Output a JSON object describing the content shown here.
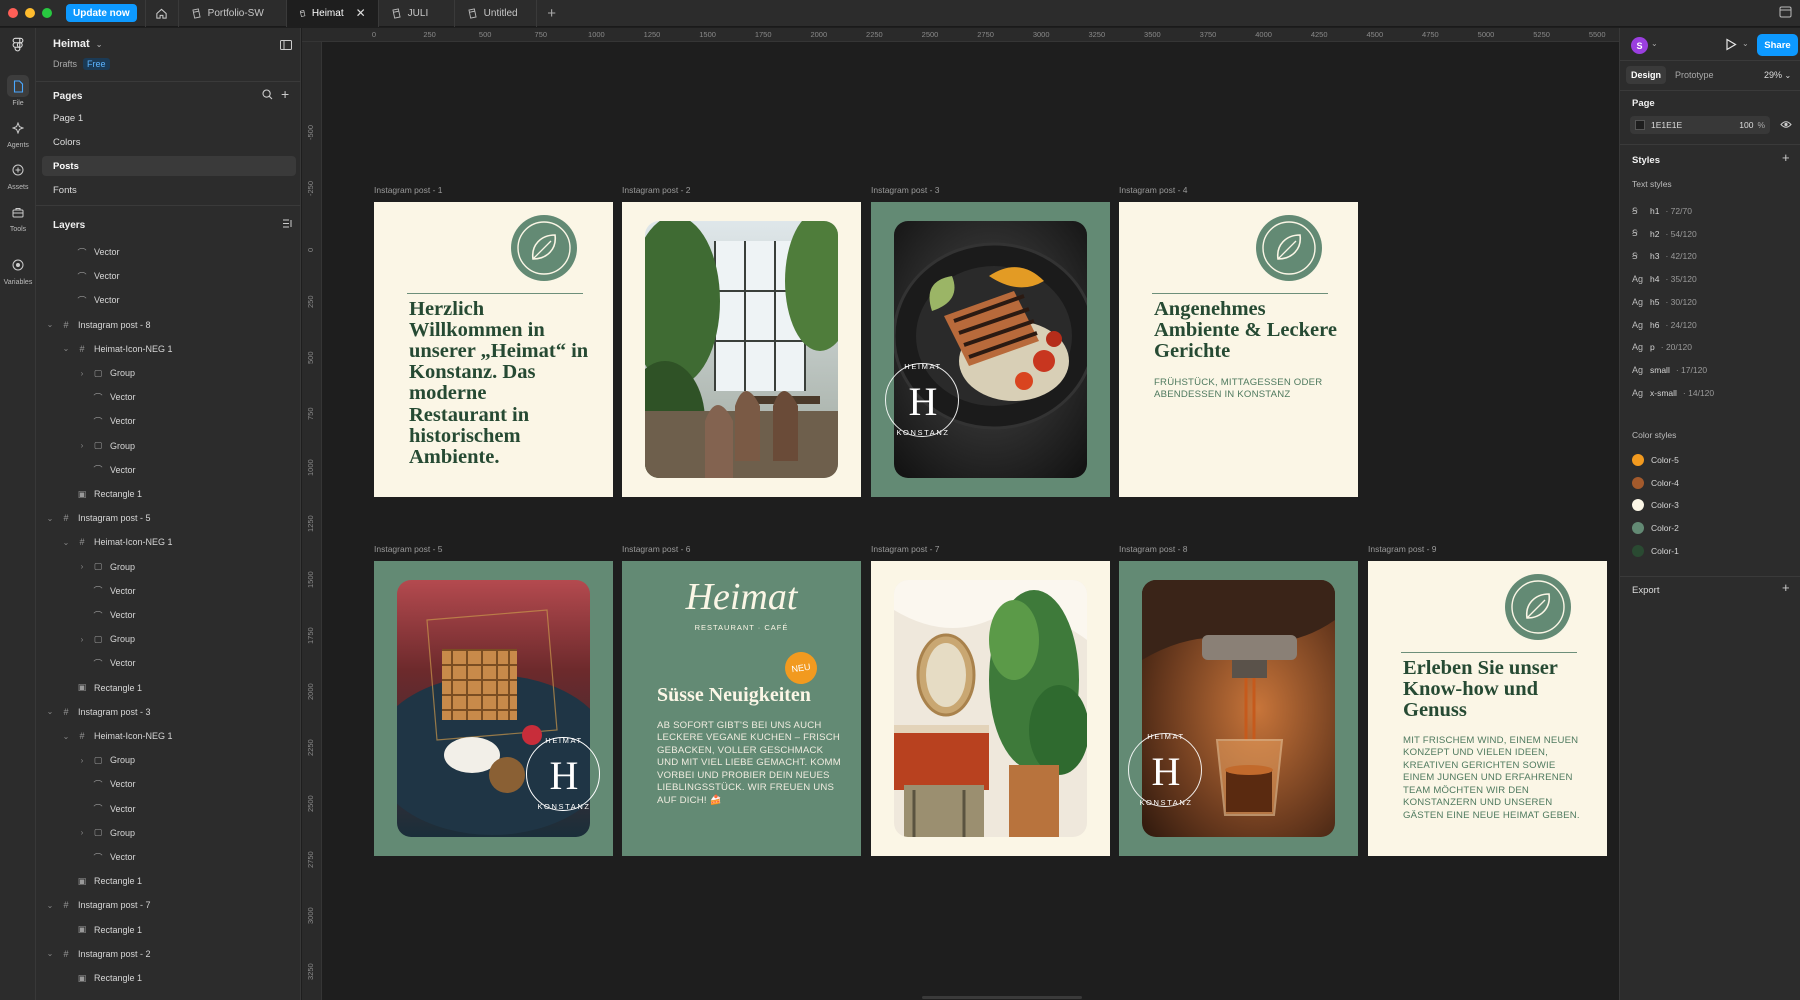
{
  "topbar": {
    "update_label": "Update now",
    "tabs": [
      {
        "label": "Portfolio-SW"
      },
      {
        "label": "Heimat"
      },
      {
        "label": "JULI"
      },
      {
        "label": "Untitled"
      }
    ]
  },
  "rail": {
    "items": [
      {
        "label": "File",
        "icon": "file-icon"
      },
      {
        "label": "Agents",
        "icon": "agents-icon"
      },
      {
        "label": "Assets",
        "icon": "assets-icon"
      },
      {
        "label": "Tools",
        "icon": "tools-icon"
      },
      {
        "label": "Variables",
        "icon": "variables-icon"
      }
    ]
  },
  "left_panel": {
    "file_name": "Heimat",
    "drafts": "Drafts",
    "plan": "Free",
    "pages_heading": "Pages",
    "pages": [
      "Page 1",
      "Colors",
      "Posts",
      "Fonts"
    ],
    "selected_page": "Posts",
    "layers_heading": "Layers",
    "layers": [
      {
        "name": "Vector",
        "type": "vector",
        "depth": 1
      },
      {
        "name": "Vector",
        "type": "vector",
        "depth": 1
      },
      {
        "name": "Vector",
        "type": "vector",
        "depth": 1
      },
      {
        "name": "Instagram post - 8",
        "type": "frame",
        "depth": 0
      },
      {
        "name": "Heimat-Icon-NEG 1",
        "type": "frame",
        "depth": 1
      },
      {
        "name": "Group",
        "type": "group",
        "depth": 2
      },
      {
        "name": "Vector",
        "type": "vector",
        "depth": 2
      },
      {
        "name": "Vector",
        "type": "vector",
        "depth": 2
      },
      {
        "name": "Group",
        "type": "group",
        "depth": 2
      },
      {
        "name": "Vector",
        "type": "vector",
        "depth": 2
      },
      {
        "name": "Rectangle 1",
        "type": "rect",
        "depth": 1
      },
      {
        "name": "Instagram post - 5",
        "type": "frame",
        "depth": 0
      },
      {
        "name": "Heimat-Icon-NEG 1",
        "type": "frame",
        "depth": 1
      },
      {
        "name": "Group",
        "type": "group",
        "depth": 2
      },
      {
        "name": "Vector",
        "type": "vector",
        "depth": 2
      },
      {
        "name": "Vector",
        "type": "vector",
        "depth": 2
      },
      {
        "name": "Group",
        "type": "group",
        "depth": 2
      },
      {
        "name": "Vector",
        "type": "vector",
        "depth": 2
      },
      {
        "name": "Rectangle 1",
        "type": "rect",
        "depth": 1
      },
      {
        "name": "Instagram post - 3",
        "type": "frame",
        "depth": 0
      },
      {
        "name": "Heimat-Icon-NEG 1",
        "type": "frame",
        "depth": 1
      },
      {
        "name": "Group",
        "type": "group",
        "depth": 2
      },
      {
        "name": "Vector",
        "type": "vector",
        "depth": 2
      },
      {
        "name": "Vector",
        "type": "vector",
        "depth": 2
      },
      {
        "name": "Group",
        "type": "group",
        "depth": 2
      },
      {
        "name": "Vector",
        "type": "vector",
        "depth": 2
      },
      {
        "name": "Rectangle 1",
        "type": "rect",
        "depth": 1
      },
      {
        "name": "Instagram post - 7",
        "type": "frame",
        "depth": 0
      },
      {
        "name": "Rectangle 1",
        "type": "rect",
        "depth": 1
      },
      {
        "name": "Instagram post - 2",
        "type": "frame",
        "depth": 0
      },
      {
        "name": "Rectangle 1",
        "type": "rect",
        "depth": 1
      }
    ]
  },
  "canvas": {
    "ruler_top": [
      "0",
      "250",
      "500",
      "750",
      "1000",
      "1250",
      "1500",
      "1750",
      "2000",
      "2250",
      "2500",
      "2750",
      "3000",
      "3250",
      "3500",
      "3750",
      "4000",
      "4250",
      "4500",
      "4750",
      "5000",
      "5250",
      "5500"
    ],
    "ruler_left": [
      "-500",
      "-250",
      "0",
      "250",
      "500",
      "750",
      "1000",
      "1250",
      "1500",
      "1750",
      "2000",
      "2250",
      "2500",
      "2750",
      "3000",
      "3250",
      "3500"
    ],
    "frames": {
      "p1": {
        "label": "Instagram post - 1",
        "headline": "Herzlich Willkommen in unserer „Heimat“ in Konstanz. Das moderne Restaurant in historischem Ambiente."
      },
      "p2": {
        "label": "Instagram post - 2",
        "photo": "restaurant interior with plants"
      },
      "p3": {
        "label": "Instagram post - 3",
        "seal_top": "HEIMAT",
        "seal_bottom": "KONSTANZ",
        "seal_letter": "H"
      },
      "p4": {
        "label": "Instagram post - 4",
        "headline": "Angenehmes Ambiente & Leckere Gerichte",
        "copy": "FRÜHSTÜCK, MITTAGESSEN ODER ABENDESSEN IN KONSTANZ"
      },
      "p5": {
        "label": "Instagram post - 5",
        "seal_top": "HEIMAT",
        "seal_bottom": "KONSTANZ",
        "seal_letter": "H"
      },
      "p6": {
        "label": "Instagram post - 6",
        "logo": "Heimat",
        "logo_sub": "RESTAURANT · CAFÉ",
        "badge": "NEU",
        "headline": "Süsse Neuigkeiten",
        "copy": "AB SOFORT GIBT'S BEI UNS AUCH LECKERE VEGANE KUCHEN – FRISCH GEBACKEN, VOLLER GESCHMACK UND MIT VIEL LIEBE GEMACHT. KOMM VORBEI UND PROBIER DEIN NEUES LIEBLINGSSTÜCK. WIR FREUEN UNS AUF DICH! 🍰"
      },
      "p7": {
        "label": "Instagram post - 7",
        "photo": "cafe interior with bench and plant"
      },
      "p8": {
        "label": "Instagram post - 8",
        "seal_top": "HEIMAT",
        "seal_bottom": "KONSTANZ",
        "seal_letter": "H"
      },
      "p9": {
        "label": "Instagram post - 9",
        "headline": "Erleben Sie unser Know-how und Genuss",
        "copy": "MIT FRISCHEM WIND, EINEM NEUEN KONZEPT UND VIELEN IDEEN, KREATIVEN GERICHTEN SOWIE EINEM JUNGEN UND ERFAHRENEN TEAM MÖCHTEN WIR DEN KONSTANZERN UND UNSEREN GÄSTEN EINE NEUE HEIMAT GEBEN."
      }
    }
  },
  "right_panel": {
    "avatar_letter": "S",
    "share_label": "Share",
    "tabs": [
      "Design",
      "Prototype"
    ],
    "zoom": "29%",
    "page_heading": "Page",
    "page_color": "1E1E1E",
    "page_opacity": "100",
    "page_opacity_unit": "%",
    "styles_heading": "Styles",
    "text_styles_heading": "Text styles",
    "text_styles": [
      {
        "glyph": "Ꞩ",
        "name": "h1",
        "meta": "72/70"
      },
      {
        "glyph": "Ꞩ",
        "name": "h2",
        "meta": "54/120"
      },
      {
        "glyph": "Ꞩ",
        "name": "h3",
        "meta": "42/120"
      },
      {
        "glyph": "Ag",
        "name": "h4",
        "meta": "35/120"
      },
      {
        "glyph": "Ag",
        "name": "h5",
        "meta": "30/120"
      },
      {
        "glyph": "Ag",
        "name": "h6",
        "meta": "24/120"
      },
      {
        "glyph": "Ag",
        "name": "p",
        "meta": "20/120"
      },
      {
        "glyph": "Ag",
        "name": "small",
        "meta": "17/120"
      },
      {
        "glyph": "Ag",
        "name": "x-small",
        "meta": "14/120"
      }
    ],
    "color_styles_heading": "Color styles",
    "color_styles": [
      {
        "name": "Color-5",
        "color": "#f29a1f"
      },
      {
        "name": "Color-4",
        "color": "#a35a2c"
      },
      {
        "name": "Color-3",
        "color": "#fbf6e6"
      },
      {
        "name": "Color-2",
        "color": "#638a74"
      },
      {
        "name": "Color-1",
        "color": "#2a4a32"
      }
    ],
    "export_heading": "Export"
  },
  "colors": {
    "accent": "#0d99ff",
    "sage": "#638a74",
    "cream": "#fbf6e6",
    "forest": "#264a33"
  }
}
